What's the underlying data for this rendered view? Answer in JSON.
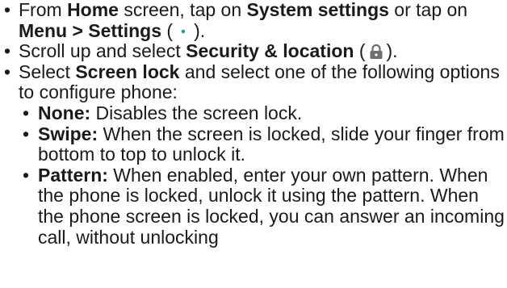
{
  "icons": {
    "settings_icon": "gear-icon",
    "security_icon": "lock-icon",
    "settings_icon_color": "#1a9e8c",
    "lock_icon_color": "#6e6e6e"
  },
  "steps": [
    {
      "t1": "From ",
      "b1": "Home",
      "t2": " screen, tap on ",
      "b2": "System settings",
      "t3": " or tap on ",
      "b3": "Menu > Settings",
      "t4": " (",
      "t5": ")."
    },
    {
      "t1": "Scroll up and select ",
      "b1": "Security & location",
      "t2": " (",
      "t3": ")."
    },
    {
      "t1": "Select ",
      "b1": "Screen lock",
      "t2": " and select one of the following options to configure phone:"
    }
  ],
  "options": [
    {
      "label": "None:",
      "text": " Disables the screen lock."
    },
    {
      "label": "Swipe:",
      "text": " When the screen is locked, slide your finger from bottom to top to unlock it."
    },
    {
      "label": "Pattern:",
      "text": " When enabled, enter your own pattern. When the phone is locked, unlock it using the pattern. When the phone screen is locked, you can answer an incoming call, without unlocking"
    }
  ]
}
